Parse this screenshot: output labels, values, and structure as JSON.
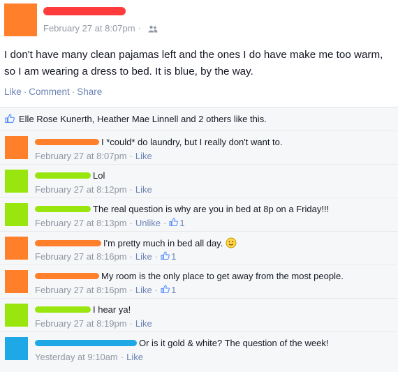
{
  "post": {
    "author_color": "#ff7f2a",
    "timestamp": "February 27 at 8:07pm",
    "separator": "·",
    "audience_icon": "friends-icon",
    "text": "I don't have many clean pajamas left and the ones I do have make me too warm, so I am wearing a dress to bed. It is blue, by the way.",
    "actions": {
      "like": "Like",
      "comment": "Comment",
      "share": "Share"
    }
  },
  "likes": {
    "icon": "thumbs-up-icon",
    "text": "Elle Rose Kunerth, Heather Mae Linnell and 2 others like this."
  },
  "comments": [
    {
      "avatar_color": "#ff7f2a",
      "name_color": "#ff7f2a",
      "text": "I *could* do laundry, but I really don't want to.",
      "time": "February 27 at 8:07pm",
      "action": "Like",
      "like_count": ""
    },
    {
      "avatar_color": "#99e60f",
      "name_color": "#99e60f",
      "text": "Lol",
      "time": "February 27 at 8:12pm",
      "action": "Like",
      "like_count": ""
    },
    {
      "avatar_color": "#99e60f",
      "name_color": "#99e60f",
      "text": "The real question is why are you in bed at 8p on a Friday!!!",
      "time": "February 27 at 8:13pm",
      "action": "Unlike",
      "like_count": "1"
    },
    {
      "avatar_color": "#ff7f2a",
      "name_color": "#ff7f2a",
      "text": "I'm pretty much in bed all day.",
      "time": "February 27 at 8:16pm",
      "action": "Like",
      "like_count": "1",
      "emoji": "smiley-icon"
    },
    {
      "avatar_color": "#ff7f2a",
      "name_color": "#ff7f2a",
      "text": "My room is the only place to get away from the most people.",
      "time": "February 27 at 8:16pm",
      "action": "Like",
      "like_count": "1"
    },
    {
      "avatar_color": "#99e60f",
      "name_color": "#99e60f",
      "text": "I hear ya!",
      "time": "February 27 at 8:19pm",
      "action": "Like",
      "like_count": ""
    },
    {
      "avatar_color": "#1ea9e6",
      "name_color": "#1ea9e6",
      "text": "Or is it gold & white? The question of the week!",
      "time": "Yesterday at 9:10am",
      "action": "Like",
      "like_count": ""
    }
  ]
}
